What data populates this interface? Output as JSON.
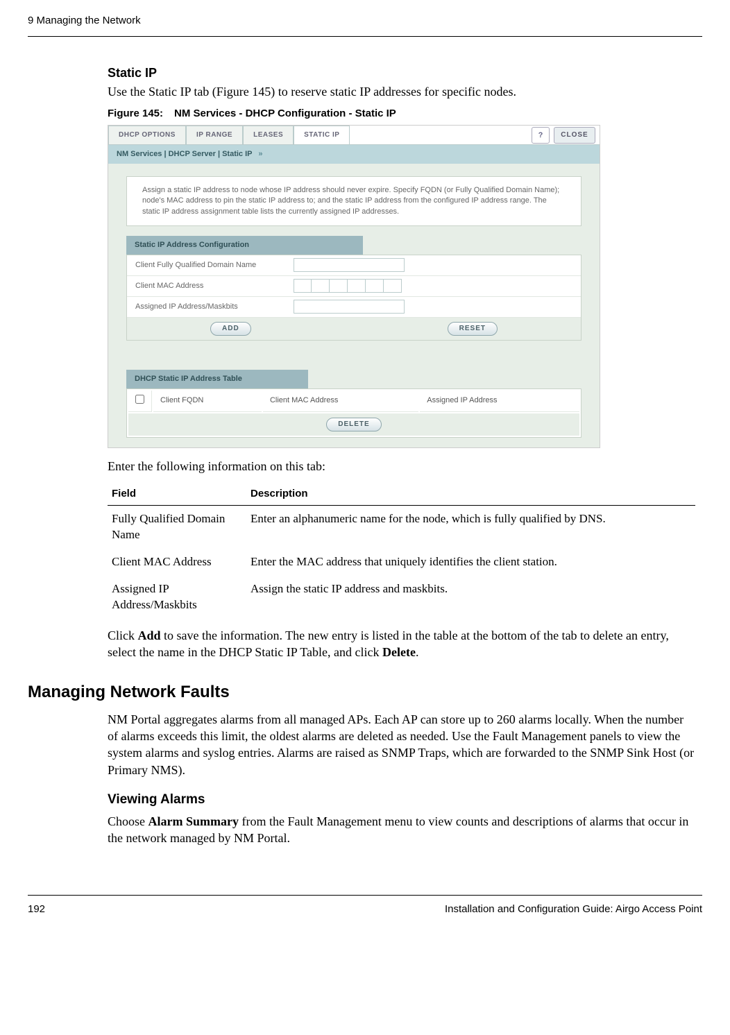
{
  "header": {
    "chapter": "9  Managing the Network"
  },
  "sections": {
    "static_ip_heading": "Static IP",
    "static_ip_intro": "Use the Static IP tab (Figure 145) to reserve static IP addresses for specific nodes.",
    "figure_label": "Figure 145:",
    "figure_title": "NM Services - DHCP Configuration - Static IP",
    "enter_info": "Enter the following information on this tab:",
    "click_add_1": "Click ",
    "click_add_bold1": "Add",
    "click_add_2": " to save the information. The new entry is listed in the table at the bottom of the tab to delete an entry, select the name in the DHCP Static IP Table, and click ",
    "click_add_bold2": "Delete",
    "click_add_3": ".",
    "mnf_heading": "Managing Network Faults",
    "mnf_body": "NM Portal aggregates alarms from all managed APs. Each AP can store up to 260 alarms locally. When the number of alarms exceeds this limit, the oldest alarms are deleted as needed. Use the Fault Management panels to view the system alarms and syslog entries. Alarms are raised as SNMP Traps, which are forwarded to the SNMP Sink Host (or Primary NMS).",
    "va_heading": "Viewing Alarms",
    "va_body_1": "Choose ",
    "va_bold": "Alarm Summary",
    "va_body_2": " from the Fault Management menu to view counts and descriptions of alarms that occur in the network managed by NM Portal."
  },
  "screenshot": {
    "tabs": {
      "dhcp_options": "DHCP OPTIONS",
      "ip_range": "IP RANGE",
      "leases": "LEASES",
      "static_ip": "STATIC IP"
    },
    "help": "?",
    "close": "CLOSE",
    "breadcrumb": "NM Services | DHCP Server | Static IP",
    "breadcrumb_sep": "»",
    "infobox": "Assign a static IP address to node whose IP address should never expire. Specify FQDN (or Fully Qualified Domain Name); node's MAC address to pin the static IP address to; and the static IP address from the configured IP address range. The static IP address assignment table lists the currently assigned IP addresses.",
    "section1": "Static IP Address Configuration",
    "form": {
      "fqdn": "Client Fully Qualified Domain Name",
      "mac": "Client MAC Address",
      "ipmask": "Assigned IP Address/Maskbits"
    },
    "btn_add": "ADD",
    "btn_reset": "RESET",
    "section2": "DHCP Static IP Address Table",
    "table": {
      "col1": "Client FQDN",
      "col2": "Client MAC Address",
      "col3": "Assigned IP Address"
    },
    "btn_delete": "DELETE"
  },
  "desc_table": {
    "h1": "Field",
    "h2": "Description",
    "rows": [
      {
        "f": "Fully Qualified Domain Name",
        "d": "Enter an alphanumeric name for the node, which is fully qualified by DNS."
      },
      {
        "f": "Client MAC Address",
        "d": "Enter the MAC address that uniquely identifies the client station."
      },
      {
        "f": "Assigned IP Address/Maskbits",
        "d": "Assign the static IP address and maskbits."
      }
    ]
  },
  "footer": {
    "page": "192",
    "title": "Installation and Configuration Guide: Airgo Access Point"
  }
}
